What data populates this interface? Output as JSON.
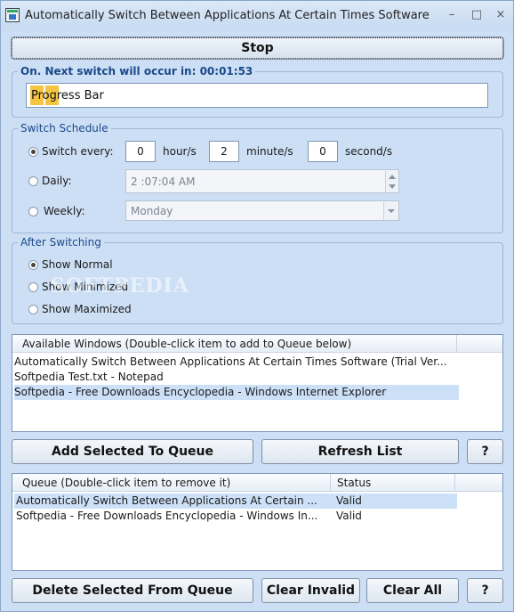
{
  "window": {
    "title": "Automatically Switch Between Applications At Certain Times Software"
  },
  "controls": {
    "minimize": "–",
    "maximize": "□",
    "close": "×"
  },
  "stop_button": "Stop",
  "status_group": {
    "title": "On. Next switch will occur in: 00:01:53",
    "progress_text": "Progress Bar",
    "progress_fraction": 0.06
  },
  "schedule": {
    "title": "Switch Schedule",
    "switch_every_label": "Switch every:",
    "hours_value": "0",
    "hours_unit": "hour/s",
    "minutes_value": "2",
    "minutes_unit": "minute/s",
    "seconds_value": "0",
    "seconds_unit": "second/s",
    "daily_label": "Daily:",
    "daily_time": "2 :07:04 AM",
    "weekly_label": "Weekly:",
    "weekly_day": "Monday",
    "selected": "switch_every"
  },
  "after_switching": {
    "title": "After Switching",
    "options": [
      "Show Normal",
      "Show Minimized",
      "Show Maximized"
    ],
    "selected": "Show Normal"
  },
  "watermark": "SOFTPEDIA",
  "available": {
    "header": "Available Windows (Double-click item to add to Queue below)",
    "items": [
      "Automatically Switch Between Applications At Certain Times Software (Trial Ver...",
      "Softpedia Test.txt - Notepad",
      "Softpedia - Free Downloads Encyclopedia - Windows Internet Explorer"
    ],
    "selected_index": 2
  },
  "buttons_mid": {
    "add": "Add Selected To Queue",
    "refresh": "Refresh List",
    "help": "?"
  },
  "queue": {
    "header_name": "Queue (Double-click item to remove it)",
    "header_status": "Status",
    "rows": [
      {
        "name": "Automatically Switch Between Applications At Certain ...",
        "status": "Valid"
      },
      {
        "name": "Softpedia - Free Downloads Encyclopedia - Windows In...",
        "status": "Valid"
      }
    ],
    "selected_index": 0
  },
  "buttons_bottom": {
    "delete": "Delete Selected From Queue",
    "clear_invalid": "Clear Invalid",
    "clear_all": "Clear All",
    "help": "?"
  }
}
